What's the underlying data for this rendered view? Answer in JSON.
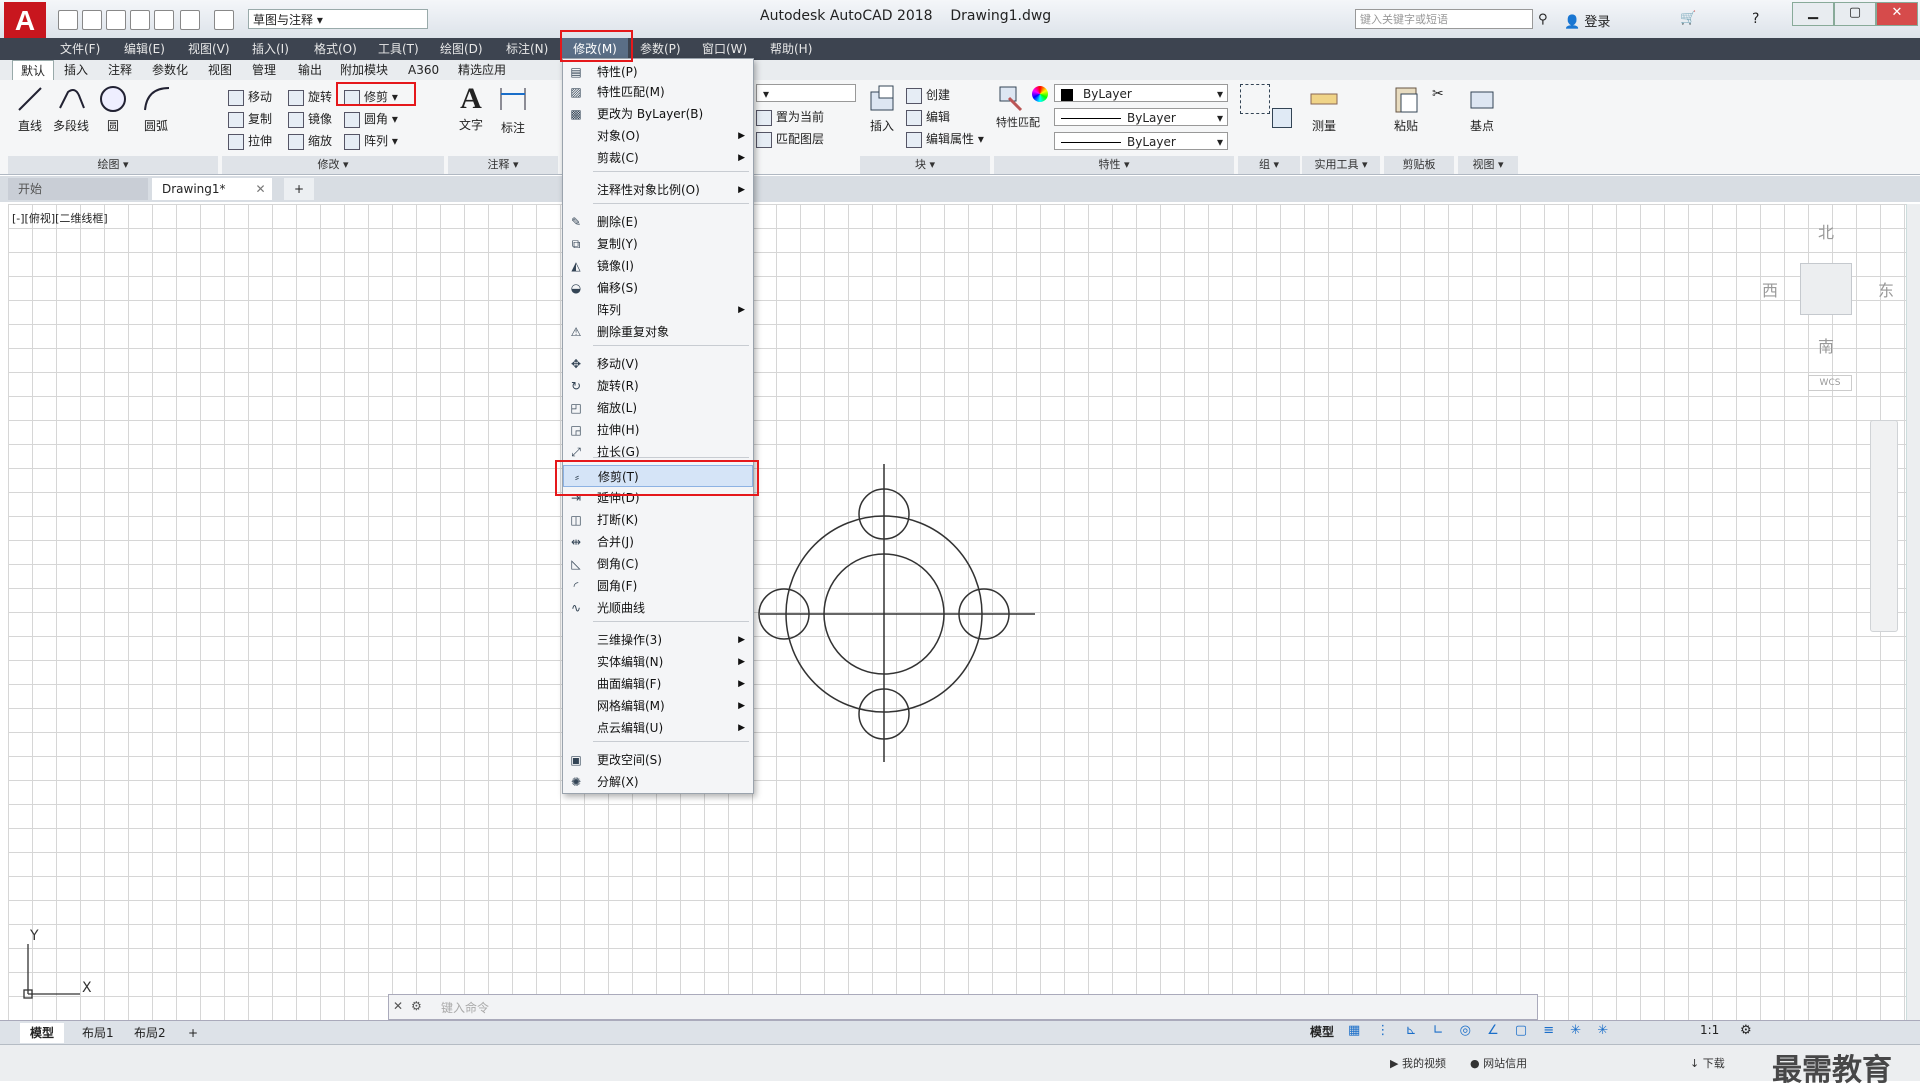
{
  "titlebar": {
    "workspace": "草图与注释",
    "app_title": "Autodesk AutoCAD 2018",
    "doc_title": "Drawing1.dwg",
    "search_placeholder": "键入关键字或短语",
    "login": "登录"
  },
  "menubar": [
    "文件(F)",
    "编辑(E)",
    "视图(V)",
    "插入(I)",
    "格式(O)",
    "工具(T)",
    "绘图(D)",
    "标注(N)",
    "修改(M)",
    "参数(P)",
    "窗口(W)",
    "帮助(H)"
  ],
  "ribbon_tabs": [
    "默认",
    "插入",
    "注释",
    "参数化",
    "视图",
    "管理",
    "输出",
    "附加模块",
    "A360",
    "精选应用"
  ],
  "ribbon": {
    "draw": {
      "items": [
        "直线",
        "多段线",
        "圆",
        "圆弧"
      ],
      "label": "绘图"
    },
    "modify": {
      "items": [
        "移动",
        "旋转",
        "修剪",
        "复制",
        "镜像",
        "圆角",
        "拉伸",
        "缩放",
        "阵列"
      ],
      "label": "修改"
    },
    "annotation": {
      "items": [
        "文字",
        "标注"
      ],
      "label": "注释"
    },
    "layer": {
      "items": [
        "置为当前",
        "匹配图层"
      ]
    },
    "block": {
      "items": [
        "插入",
        "创建",
        "编辑",
        "编辑属性"
      ],
      "label": "块"
    },
    "properties": {
      "items": [
        "特性匹配",
        "ByLayer",
        "ByLayer",
        "ByLayer"
      ],
      "label": "特性"
    },
    "group": {
      "label": "组"
    },
    "utilities": {
      "items": [
        "测量"
      ],
      "label": "实用工具"
    },
    "clipboard": {
      "items": [
        "粘贴"
      ],
      "label": "剪贴板"
    },
    "view": {
      "items": [
        "基点"
      ],
      "label": "视图"
    }
  },
  "doc_tabs": [
    "开始",
    "Drawing1*"
  ],
  "view_label": "[-][俯视][二维线框]",
  "dropdown": {
    "items": [
      {
        "label": "特性(P)",
        "icon": "properties-icon",
        "sub": false
      },
      {
        "label": "特性匹配(M)",
        "icon": "match-properties-icon",
        "sub": false
      },
      {
        "label": "更改为 ByLayer(B)",
        "icon": "bylayer-icon",
        "sub": false
      },
      {
        "label": "对象(O)",
        "icon": "",
        "sub": true
      },
      {
        "label": "剪裁(C)",
        "icon": "",
        "sub": true
      },
      {
        "label": "注释性对象比例(O)",
        "icon": "",
        "sub": true
      },
      {
        "label": "删除(E)",
        "icon": "erase-icon",
        "sub": false
      },
      {
        "label": "复制(Y)",
        "icon": "copy-icon",
        "sub": false
      },
      {
        "label": "镜像(I)",
        "icon": "mirror-icon",
        "sub": false
      },
      {
        "label": "偏移(S)",
        "icon": "offset-icon",
        "sub": false
      },
      {
        "label": "阵列",
        "icon": "",
        "sub": true
      },
      {
        "label": "删除重复对象",
        "icon": "overkill-icon",
        "sub": false
      },
      {
        "label": "移动(V)",
        "icon": "move-icon",
        "sub": false
      },
      {
        "label": "旋转(R)",
        "icon": "rotate-icon",
        "sub": false
      },
      {
        "label": "缩放(L)",
        "icon": "scale-icon",
        "sub": false
      },
      {
        "label": "拉伸(H)",
        "icon": "stretch-icon",
        "sub": false
      },
      {
        "label": "拉长(G)",
        "icon": "lengthen-icon",
        "sub": false
      },
      {
        "label": "修剪(T)",
        "icon": "trim-icon",
        "sub": false
      },
      {
        "label": "延伸(D)",
        "icon": "extend-icon",
        "sub": false
      },
      {
        "label": "打断(K)",
        "icon": "break-icon",
        "sub": false
      },
      {
        "label": "合并(J)",
        "icon": "join-icon",
        "sub": false
      },
      {
        "label": "倒角(C)",
        "icon": "chamfer-icon",
        "sub": false
      },
      {
        "label": "圆角(F)",
        "icon": "fillet-icon",
        "sub": false
      },
      {
        "label": "光顺曲线",
        "icon": "blend-icon",
        "sub": false
      },
      {
        "label": "三维操作(3)",
        "icon": "",
        "sub": true
      },
      {
        "label": "实体编辑(N)",
        "icon": "",
        "sub": true
      },
      {
        "label": "曲面编辑(F)",
        "icon": "",
        "sub": true
      },
      {
        "label": "网格编辑(M)",
        "icon": "",
        "sub": true
      },
      {
        "label": "点云编辑(U)",
        "icon": "",
        "sub": true
      },
      {
        "label": "更改空间(S)",
        "icon": "changespace-icon",
        "sub": false
      },
      {
        "label": "分解(X)",
        "icon": "explode-icon",
        "sub": false
      }
    ]
  },
  "viewcube": {
    "north": "北",
    "south": "南",
    "east": "东",
    "west": "西",
    "wcs": "WCS"
  },
  "command_placeholder": "键入命令",
  "layout_tabs": [
    "模型",
    "布局1",
    "布局2"
  ],
  "status": {
    "model": "模型",
    "scale": "1:1"
  },
  "taskbar": {
    "items": [
      "我的视频",
      "网站信用",
      "下载"
    ]
  },
  "watermark": "最需教育",
  "ucs": {
    "x": "X",
    "y": "Y"
  }
}
